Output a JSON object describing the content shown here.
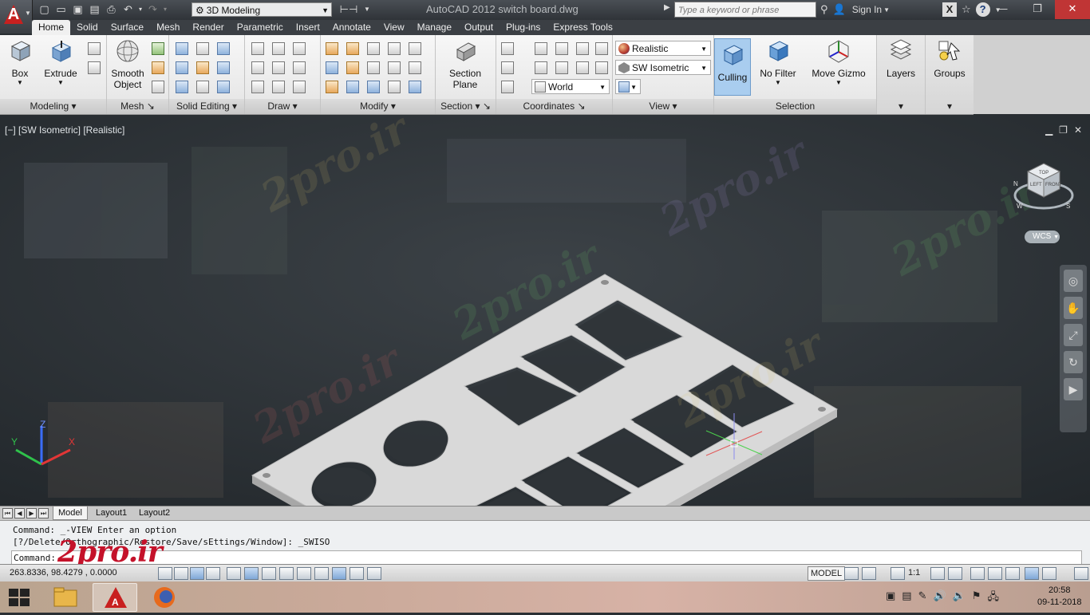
{
  "app": {
    "title": "AutoCAD 2012    switch board.dwg",
    "workspace": "3D Modeling",
    "search_placeholder": "Type a keyword or phrase",
    "sign_in": "Sign In"
  },
  "ribbon_tabs": [
    "Home",
    "Solid",
    "Surface",
    "Mesh",
    "Render",
    "Parametric",
    "Insert",
    "Annotate",
    "View",
    "Manage",
    "Output",
    "Plug-ins",
    "Express Tools"
  ],
  "active_tab": "Home",
  "ribbon": {
    "box_label": "Box",
    "extrude_label": "Extrude",
    "smooth_object_label1": "Smooth",
    "smooth_object_label2": "Object",
    "section_plane_label1": "Section",
    "section_plane_label2": "Plane",
    "visual_style": "Realistic",
    "view_preset": "SW Isometric",
    "ucs": "World",
    "culling_label": "Culling",
    "no_filter_label": "No Filter",
    "move_gizmo_label": "Move Gizmo",
    "layers_label": "Layers",
    "groups_label": "Groups",
    "panels": {
      "modeling": "Modeling",
      "mesh": "Mesh",
      "solid_editing": "Solid Editing",
      "draw": "Draw",
      "modify": "Modify",
      "section": "Section",
      "coordinates": "Coordinates",
      "view": "View",
      "selection": "Selection"
    }
  },
  "viewport": {
    "label": "[−] [SW Isometric] [Realistic]",
    "wcs": "WCS",
    "watermark": "2pro.ir",
    "viewcube_top": "TOP",
    "viewcube_left": "LEFT",
    "viewcube_front": "FRONT",
    "compass_n": "N",
    "compass_w": "W",
    "compass_s": "S"
  },
  "layout_tabs": [
    "Model",
    "Layout1",
    "Layout2"
  ],
  "command": {
    "line1": "Command: _-VIEW Enter an option",
    "line2": "[?/Delete/Orthographic/Restore/Save/sEttings/Window]: _SWISO",
    "prompt": "Command:",
    "brand": "2pro.ir"
  },
  "status": {
    "coords": "263.8336, 98.4279 , 0.0000",
    "model": "MODEL",
    "scale": "1:1"
  },
  "taskbar": {
    "time": "20:58",
    "date": "09-11-2018"
  },
  "colors": {
    "ribbon_bg": "#f0f0f0",
    "viewport_bg": "#2e3337",
    "autocad_red": "#c8201f",
    "plate": "#d9d9d9"
  }
}
